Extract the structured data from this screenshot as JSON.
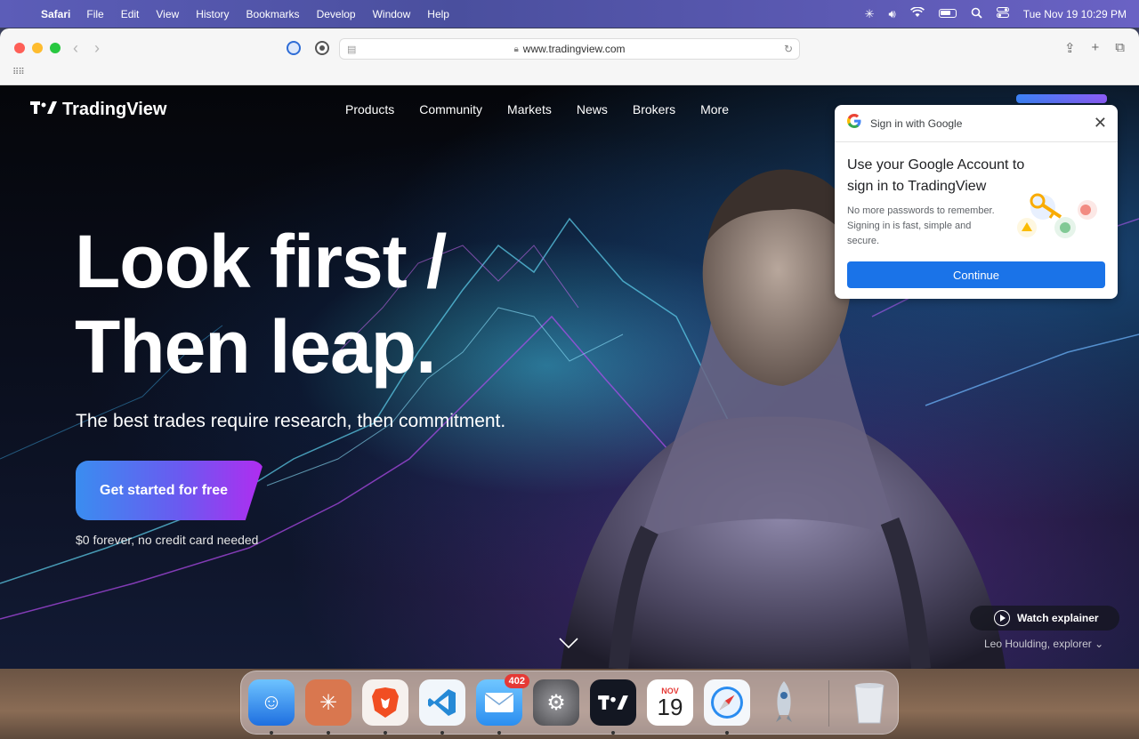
{
  "menubar": {
    "app_name": "Safari",
    "items": [
      "File",
      "Edit",
      "View",
      "History",
      "Bookmarks",
      "Develop",
      "Window",
      "Help"
    ],
    "clock": "Tue Nov 19  10:29 PM"
  },
  "browser": {
    "url": "www.tradingview.com"
  },
  "site": {
    "logo": "TradingView",
    "nav": [
      "Products",
      "Community",
      "Markets",
      "News",
      "Brokers",
      "More"
    ],
    "hero_line1": "Look first /",
    "hero_line2": "Then leap.",
    "subtitle": "The best trades require research, then commitment.",
    "cta": "Get started for free",
    "cta_note": "$0 forever, no credit card needed",
    "watch": "Watch explainer",
    "credit": "Leo Houlding, explorer"
  },
  "google_popup": {
    "header": "Sign in with Google",
    "title": "Use your Google Account to sign in to TradingView",
    "description": "No more passwords to remember. Signing in is fast, simple and secure.",
    "button": "Continue"
  },
  "dock": {
    "mail_badge": "402",
    "calendar_month": "NOV",
    "calendar_day": "19"
  }
}
